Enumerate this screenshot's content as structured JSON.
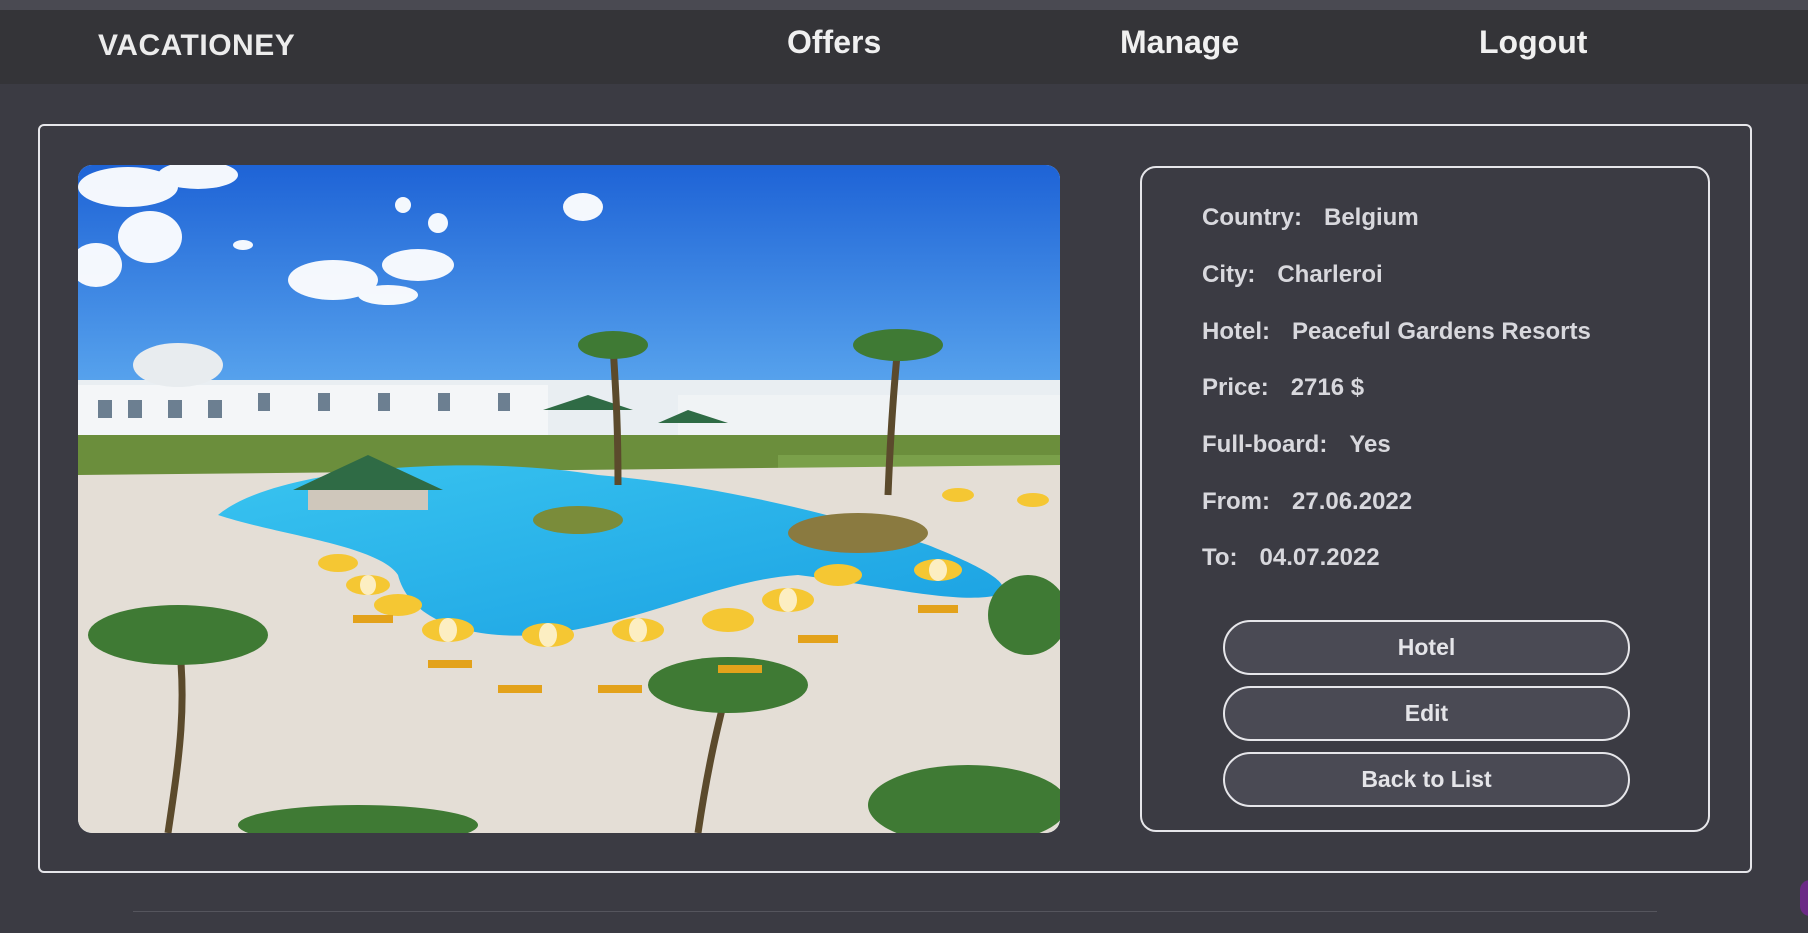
{
  "navbar": {
    "brand": "VACATIONEY",
    "links": [
      {
        "label": "Offers"
      },
      {
        "label": "Manage"
      },
      {
        "label": "Logout"
      }
    ]
  },
  "offer": {
    "image_alt": "resort-pool-photo",
    "fields": [
      {
        "label": "Country:",
        "value": "Belgium"
      },
      {
        "label": "City:",
        "value": "Charleroi"
      },
      {
        "label": "Hotel:",
        "value": "Peaceful Gardens Resorts"
      },
      {
        "label": "Price:",
        "value": "2716 $"
      },
      {
        "label": "Full-board:",
        "value": "Yes"
      },
      {
        "label": "From:",
        "value": "27.06.2022"
      },
      {
        "label": "To:",
        "value": "04.07.2022"
      }
    ],
    "buttons": {
      "hotel": "Hotel",
      "edit": "Edit",
      "back": "Back to List"
    }
  },
  "colors": {
    "page_bg": "#3b3b43",
    "navbar_bg": "#343438",
    "button_bg": "#4a4a54",
    "border": "#e6e6ea"
  }
}
